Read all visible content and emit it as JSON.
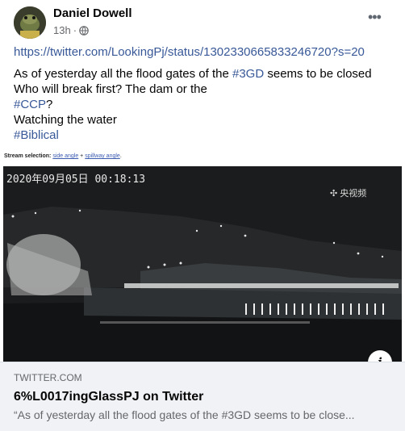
{
  "author": {
    "name": "Daniel Dowell",
    "time": "13h",
    "separator": "·",
    "audience_icon": "globe-icon"
  },
  "more_label": "•••",
  "post": {
    "link": "https://twitter.com/LookingPj/status/1302330665833246720?s=20",
    "line1_pre": "As of yesterday all the flood gates of the ",
    "line1_tag": "#3GD",
    "line1_post": " seems to be closed",
    "line2": "Who will break first? The dam or the",
    "line3_tag": "#CCP",
    "line3_post": "?",
    "line4": "Watching the water",
    "line5_tag": "#Biblical"
  },
  "preview": {
    "stream_label": "Stream selection:",
    "stream_link1": "side angle",
    "stream_sep": " + ",
    "stream_link2": "spillway angle",
    "stream_end": ".",
    "timestamp": "2020年09月05日  00:18:13",
    "broadcaster": "央视频",
    "info_label": "i",
    "domain": "TWITTER.COM",
    "title": "6%L0017ingGlassPJ on Twitter",
    "description": "“As of yesterday all the flood gates of the #3GD seems to be close..."
  }
}
